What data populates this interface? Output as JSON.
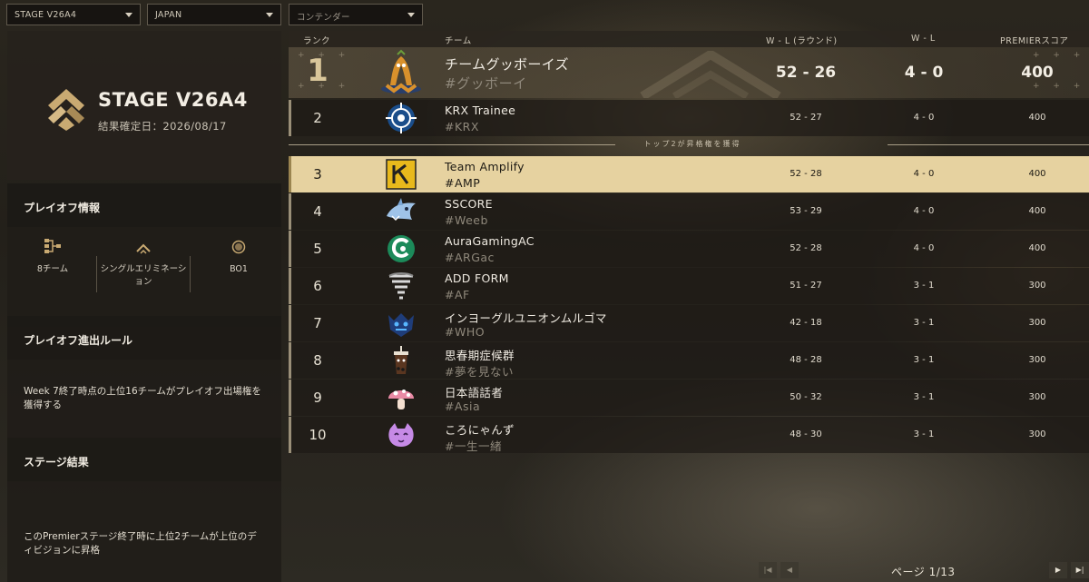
{
  "filters": {
    "stage": "STAGE V26A4",
    "region": "JAPAN",
    "tier": "コンテンダー"
  },
  "stage": {
    "title": "STAGE V26A4",
    "date": "結果確定日：2026/08/17"
  },
  "playoff": {
    "heading": "プレイオフ情報",
    "items": [
      {
        "label": "8チーム",
        "icon": "bracket-icon"
      },
      {
        "label": "シングルエリミネーション",
        "icon": "chevron-up-icon"
      },
      {
        "label": "BO1",
        "icon": "circle-icon"
      }
    ]
  },
  "rule": {
    "heading": "プレイオフ進出ルール",
    "body": "Week 7終了時点の上位16チームがプレイオフ出場権を獲得する"
  },
  "result": {
    "heading": "ステージ結果",
    "body": "このPremierステージ終了時に上位2チームが上位のディビジョンに昇格"
  },
  "table": {
    "headers": {
      "rank": "ランク",
      "team": "チーム",
      "wl_rounds": "W - L (ラウンド)",
      "wl": "W - L",
      "score": "PREMIERスコア"
    },
    "divider_text": "トップ2が昇格権を獲得",
    "rows": [
      {
        "rank": "1",
        "name": "チームグッボーイズ",
        "tag": "#グッボーイ",
        "wlr": "52 - 26",
        "wl": "4 - 0",
        "score": "400"
      },
      {
        "rank": "2",
        "name": "KRX Trainee",
        "tag": "#KRX",
        "wlr": "52 - 27",
        "wl": "4 - 0",
        "score": "400"
      },
      {
        "rank": "3",
        "name": "Team Amplify",
        "tag": "#AMP",
        "wlr": "52 - 28",
        "wl": "4 - 0",
        "score": "400"
      },
      {
        "rank": "4",
        "name": "SSCORE",
        "tag": "#Weeb",
        "wlr": "53 - 29",
        "wl": "4 - 0",
        "score": "400"
      },
      {
        "rank": "5",
        "name": "AuraGamingAC",
        "tag": "#ARGac",
        "wlr": "52 - 28",
        "wl": "4 - 0",
        "score": "400"
      },
      {
        "rank": "6",
        "name": "ADD FORM",
        "tag": "#AF",
        "wlr": "51 - 27",
        "wl": "3 - 1",
        "score": "300"
      },
      {
        "rank": "7",
        "name": "インヨーグルユニオンムルゴマ",
        "tag": "#WHO",
        "wlr": "42 - 18",
        "wl": "3 - 1",
        "score": "300"
      },
      {
        "rank": "8",
        "name": "思春期症候群",
        "tag": "#夢を見ない",
        "wlr": "48 - 28",
        "wl": "3 - 1",
        "score": "300"
      },
      {
        "rank": "9",
        "name": "日本語話者",
        "tag": "#Asia",
        "wlr": "50 - 32",
        "wl": "3 - 1",
        "score": "300"
      },
      {
        "rank": "10",
        "name": "ころにゃんず",
        "tag": "#一生一緒",
        "wlr": "48 - 30",
        "wl": "3 - 1",
        "score": "300"
      }
    ]
  },
  "pager": {
    "text": "ページ 1/13"
  },
  "colors": {
    "highlight_row": "#e6d2a0",
    "accent": "#d9c69a"
  }
}
